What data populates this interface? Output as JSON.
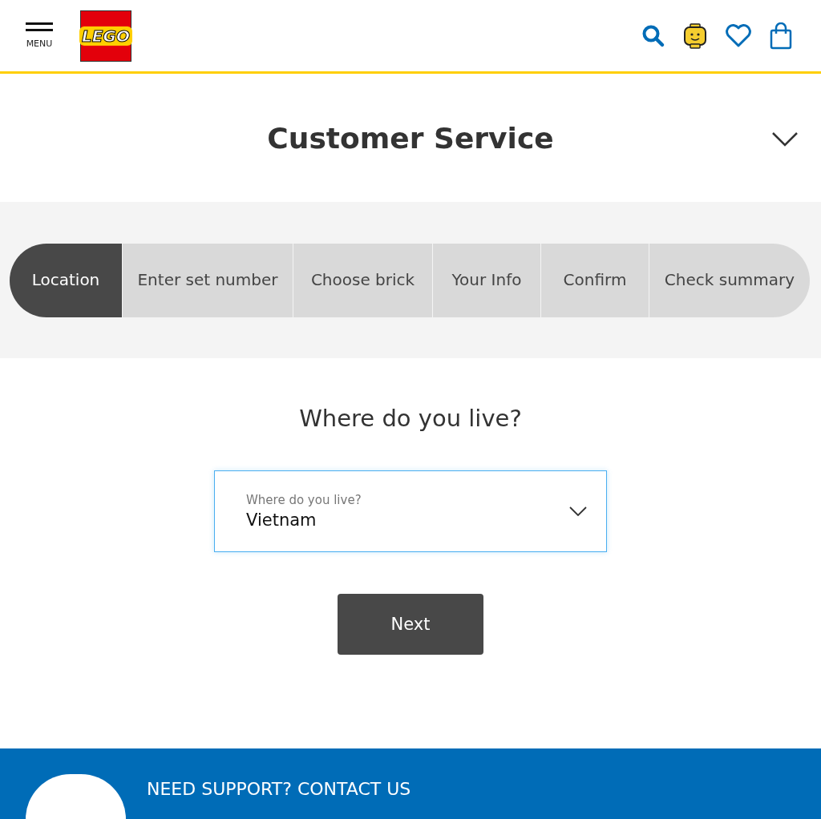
{
  "header": {
    "menu_label": "MENU",
    "logo_text": "LEGO"
  },
  "title_bar": {
    "title": "Customer Service",
    "expanded": false
  },
  "steps": [
    {
      "label": "Location",
      "selected": true
    },
    {
      "label": "Enter set number",
      "selected": false
    },
    {
      "label": "Choose brick",
      "selected": false
    },
    {
      "label": "Your Info",
      "selected": false
    },
    {
      "label": "Confirm",
      "selected": false
    },
    {
      "label": "Check summary",
      "selected": false
    }
  ],
  "question": "Where do you live?",
  "country_select": {
    "label": "Where do you live?",
    "value": "Vietnam"
  },
  "next_button": "Next",
  "support_banner": {
    "title": "NEED SUPPORT? CONTACT US"
  }
}
